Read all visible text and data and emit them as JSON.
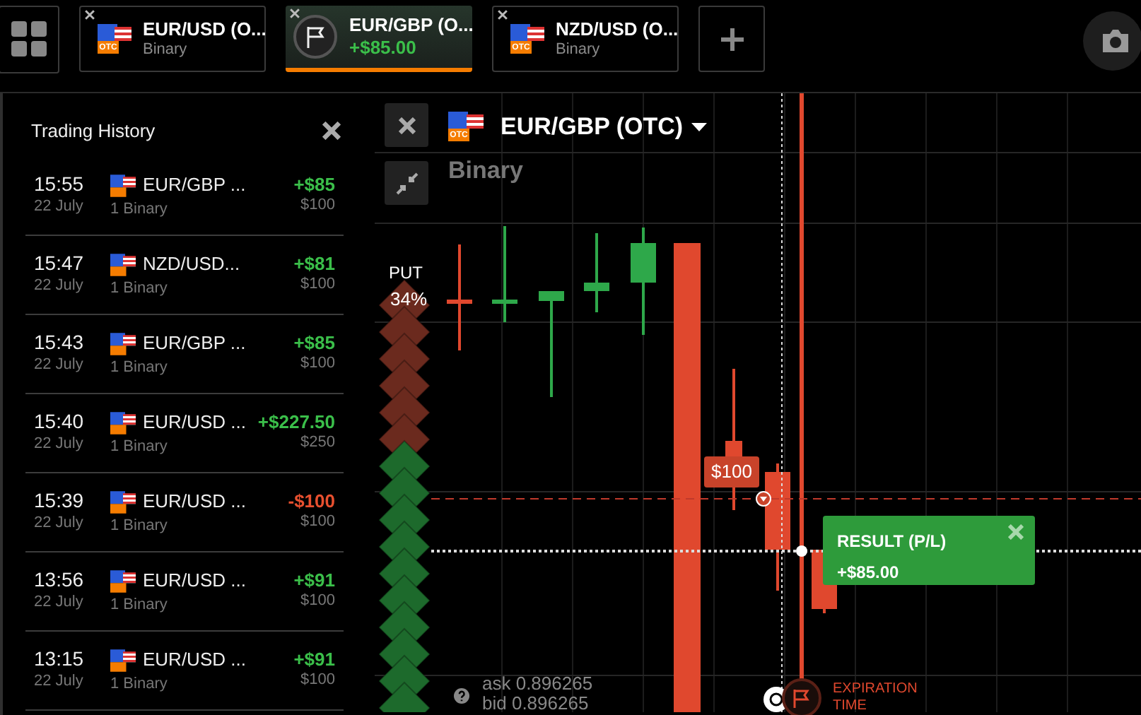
{
  "tabs": [
    {
      "kind": "asset",
      "title": "EUR/USD (O...",
      "subtitle": "Binary",
      "badge": "OTC",
      "selected": false
    },
    {
      "kind": "result",
      "title": "EUR/GBP (O...",
      "subtitle": "+$85.00",
      "selected": true
    },
    {
      "kind": "asset",
      "title": "NZD/USD (O...",
      "subtitle": "Binary",
      "badge": "OTC",
      "selected": false
    }
  ],
  "history": {
    "title": "Trading History",
    "trades": [
      {
        "time": "15:55",
        "date": "22 July",
        "asset": "EUR/GBP ...",
        "type": "1 Binary",
        "profit": "+$85",
        "amount": "$100",
        "loss": false
      },
      {
        "time": "15:47",
        "date": "22 July",
        "asset": "NZD/USD...",
        "type": "1 Binary",
        "profit": "+$81",
        "amount": "$100",
        "loss": false
      },
      {
        "time": "15:43",
        "date": "22 July",
        "asset": "EUR/GBP ...",
        "type": "1 Binary",
        "profit": "+$85",
        "amount": "$100",
        "loss": false
      },
      {
        "time": "15:40",
        "date": "22 July",
        "asset": "EUR/USD ...",
        "type": "1 Binary",
        "profit": "+$227.50",
        "amount": "$250",
        "loss": false
      },
      {
        "time": "15:39",
        "date": "22 July",
        "asset": "EUR/USD ...",
        "type": "1 Binary",
        "profit": "-$100",
        "amount": "$100",
        "loss": true
      },
      {
        "time": "13:56",
        "date": "22 July",
        "asset": "EUR/USD ...",
        "type": "1 Binary",
        "profit": "+$91",
        "amount": "$100",
        "loss": false
      },
      {
        "time": "13:15",
        "date": "22 July",
        "asset": "EUR/USD ...",
        "type": "1 Binary",
        "profit": "+$91",
        "amount": "$100",
        "loss": false
      }
    ]
  },
  "chart": {
    "asset": "EUR/GBP (OTC)",
    "badge": "OTC",
    "instrument": "Binary",
    "put_label": "PUT",
    "put_share": "34%",
    "trade_label": "$100",
    "result": {
      "title": "RESULT (P/L)",
      "value": "+$85.00"
    },
    "ask": "ask 0.896265",
    "bid": "bid 0.896265",
    "expiration": "EXPIRATION TIME"
  }
}
